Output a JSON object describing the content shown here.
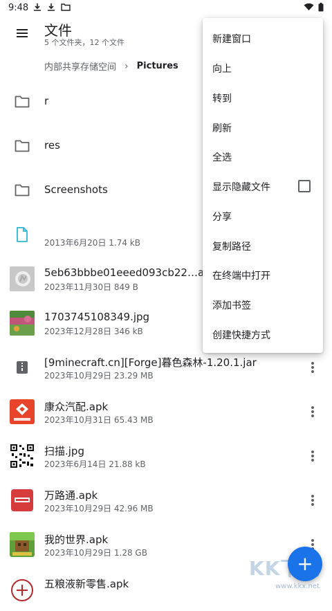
{
  "status_bar": {
    "time": "9:48"
  },
  "header": {
    "title": "文件",
    "subtitle": "5 个文件夹，12 个文件"
  },
  "breadcrumb": {
    "root": "内部共享存储空间",
    "separator": "›",
    "current": "Pictures"
  },
  "files": [
    {
      "name": "r",
      "meta": "",
      "type": "folder"
    },
    {
      "name": "res",
      "meta": "",
      "type": "folder"
    },
    {
      "name": "Screenshots",
      "meta": "",
      "type": "folder"
    },
    {
      "name": "",
      "meta": "2013年6月20日   1.74 kB",
      "type": "file"
    },
    {
      "name": "5eb63bbbe01eeed093cb22…a7d932",
      "meta": "2023年11月30日   849 B",
      "type": "image"
    },
    {
      "name": "1703745108349.jpg",
      "meta": "2023年12月28日   346 kB",
      "type": "image"
    },
    {
      "name": "[9minecraft.cn][Forge]暮色森林-1.20.1.jar",
      "meta": "2023年10月29日   23.29 MB",
      "type": "jar"
    },
    {
      "name": "康众汽配.apk",
      "meta": "2023年10月31日   65.43 MB",
      "type": "apk"
    },
    {
      "name": "扫描.jpg",
      "meta": "2023年6月14日   21.88 kB",
      "type": "image"
    },
    {
      "name": "万路通.apk",
      "meta": "2023年10月29日   42.96 MB",
      "type": "apk"
    },
    {
      "name": "我的世界.apk",
      "meta": "2023年10月29日   1.28 GB",
      "type": "apk"
    },
    {
      "name": "五粮液新零售.apk",
      "meta": "",
      "type": "apk"
    }
  ],
  "icons": {
    "folder": "folder-icon",
    "file": "document-icon",
    "more": "more-vert-icon",
    "fab": "plus-icon"
  },
  "colors": {
    "accent": "#1a73e8",
    "file_icon": "#29b6d8"
  },
  "menu": {
    "items": [
      "新建窗口",
      "向上",
      "转到",
      "刷新",
      "全选",
      "显示隐藏文件",
      "分享",
      "复制路径",
      "在终端中打开",
      "添加书签",
      "创建快捷方式"
    ],
    "show_hidden_checked": false
  },
  "fab": {
    "label": "+"
  },
  "watermark": {
    "big": "KK下载",
    "small": "www.kkx.net"
  }
}
